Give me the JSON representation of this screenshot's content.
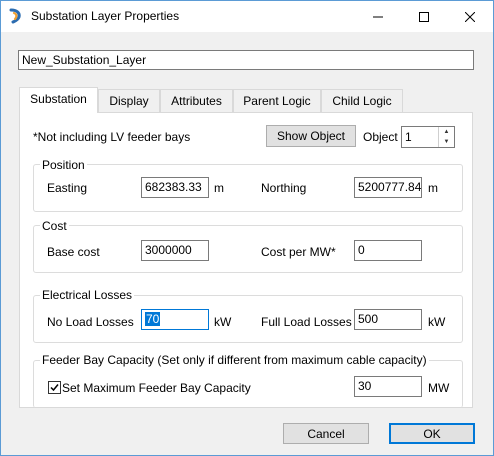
{
  "window": {
    "title": "Substation Layer Properties"
  },
  "layer_name": "New_Substation_Layer",
  "tabs": [
    {
      "label": "Substation",
      "active": true
    },
    {
      "label": "Display"
    },
    {
      "label": "Attributes"
    },
    {
      "label": "Parent Logic"
    },
    {
      "label": "Child Logic"
    }
  ],
  "note": "*Not including LV feeder bays",
  "show_object_label": "Show Object",
  "object_label": "Object",
  "object_value": "1",
  "position": {
    "title": "Position",
    "easting_label": "Easting",
    "easting_value": "682383.33",
    "easting_unit": "m",
    "northing_label": "Northing",
    "northing_value": "5200777.84",
    "northing_unit": "m"
  },
  "cost": {
    "title": "Cost",
    "base_label": "Base cost",
    "base_value": "3000000",
    "per_mw_label": "Cost per MW*",
    "per_mw_value": "0"
  },
  "losses": {
    "title": "Electrical Losses",
    "no_load_label": "No Load Losses",
    "no_load_value": "70",
    "no_load_unit": "kW",
    "full_load_label": "Full Load Losses",
    "full_load_value": "500",
    "full_load_unit": "kW"
  },
  "feeder": {
    "title": "Feeder Bay Capacity (Set only if different from maximum cable capacity)",
    "checkbox_label": "Set Maximum Feeder Bay Capacity",
    "checked": true,
    "value": "30",
    "unit": "MW"
  },
  "buttons": {
    "cancel": "Cancel",
    "ok": "OK"
  },
  "colors": {
    "accent": "#0078d7",
    "icon_blue": "#2b6cb0",
    "icon_orange": "#f0a030"
  }
}
